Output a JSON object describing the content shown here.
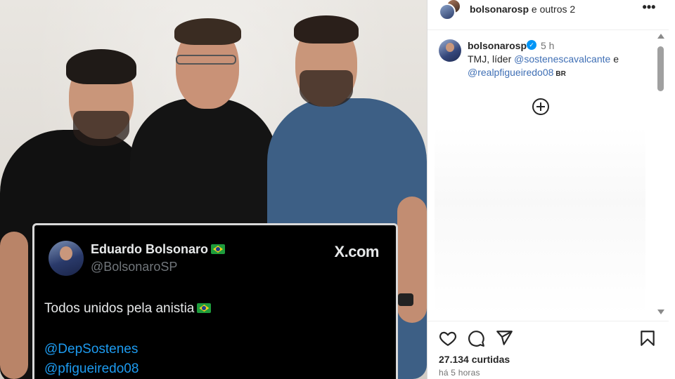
{
  "tweet": {
    "name": "Eduardo Bolsonaro",
    "handle": "@BolsonaroSP",
    "brand": "X.com",
    "text": "Todos unidos pela anistia",
    "mentions": [
      "@DepSostenes",
      "@pfigueiredo08"
    ]
  },
  "header": {
    "username": "bolsonarosp",
    "collab_suffix": "e outros 2",
    "more_label": "•••"
  },
  "caption": {
    "username": "bolsonarosp",
    "time": "5 h",
    "prefix": "TMJ, líder",
    "mention1": "@sostenescavalcante",
    "conj": "e",
    "mention2": "@realpfigueiredo08",
    "country_code": "BR"
  },
  "actions": {
    "like_icon": "heart-icon",
    "comment_icon": "comment-icon",
    "share_icon": "send-icon",
    "save_icon": "bookmark-icon"
  },
  "footer": {
    "likes": "27.134 curtidas",
    "time_ago": "há 5 horas"
  },
  "colors": {
    "link": "#00376b",
    "verified": "#0095f6",
    "tweet_link": "#1d9bf0"
  }
}
